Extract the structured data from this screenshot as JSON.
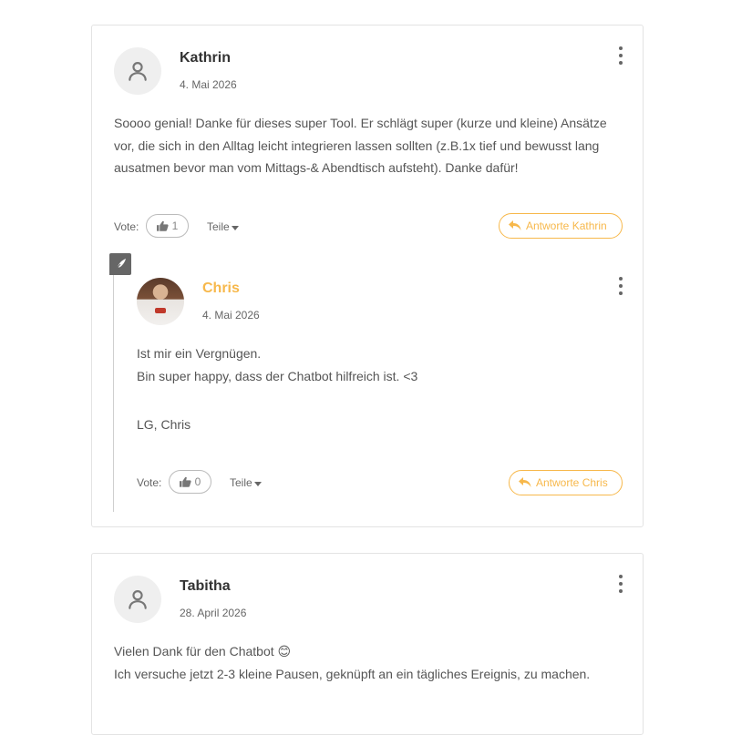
{
  "comments": [
    {
      "author": "Kathrin",
      "date": "4. Mai 2026",
      "text": "Soooo genial! Danke für dieses super Tool. Er schlägt super (kurze und kleine) Ansätze vor, die sich in den Alltag leicht integrieren lassen sollten (z.B.1x tief und bewusst lang ausatmen bevor man vom Mittags-& Abendtisch aufsteht). Danke dafür!",
      "vote_label": "Vote:",
      "votes": "1",
      "share_label": "Teile",
      "reply_label": "Antworte Kathrin",
      "avatar_icon": "user-icon",
      "replies": [
        {
          "author": "Chris",
          "date": "4. Mai 2026",
          "lines": [
            "Ist mir ein Vergnügen.",
            "Bin super happy, dass der Chatbot hilfreich ist. <3",
            "",
            "LG, Chris"
          ],
          "vote_label": "Vote:",
          "votes": "0",
          "share_label": "Teile",
          "reply_label": "Antworte Chris",
          "avatar_icon": "profile-photo"
        }
      ]
    },
    {
      "author": "Tabitha",
      "date": "28. April 2026",
      "lines": [
        "Vielen Dank für den Chatbot 😊",
        "Ich versuche jetzt 2-3 kleine Pausen, geknüpft an ein tägliches Ereignis, zu machen."
      ],
      "avatar_icon": "user-icon"
    }
  ],
  "colors": {
    "accent": "#f7b84b",
    "text": "#555555",
    "border": "#e3e3e3",
    "badge": "#666666"
  },
  "icons": {
    "kebab": "more-vertical-icon",
    "thumb": "thumbs-up-icon",
    "reply": "reply-arrow-icon",
    "badge": "feather-reply-icon"
  }
}
